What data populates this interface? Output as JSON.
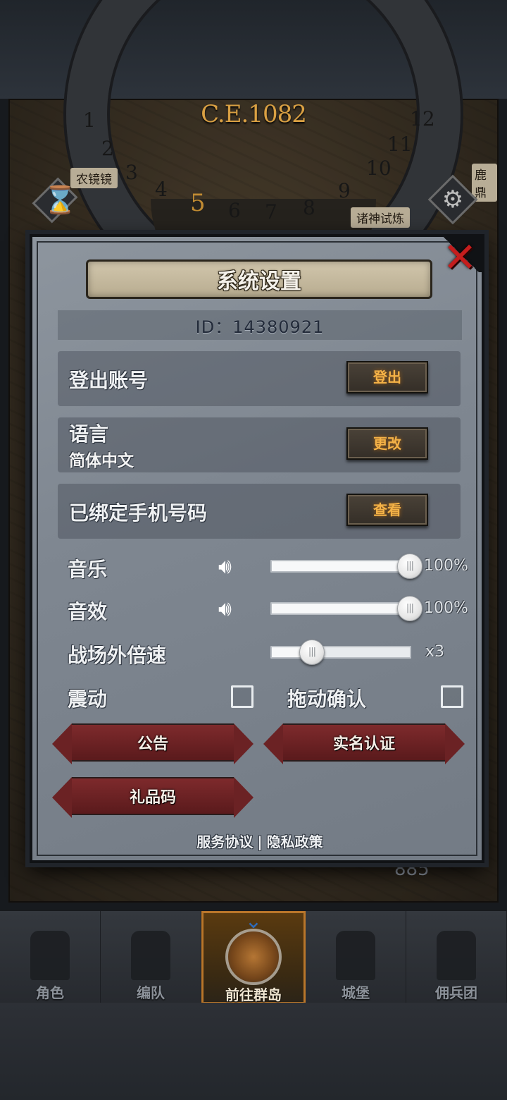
{
  "scene": {
    "era": "C.E.1082",
    "dial_numbers": [
      "1",
      "2",
      "3",
      "4",
      "5",
      "6",
      "7",
      "8",
      "9",
      "10",
      "11",
      "12"
    ],
    "active_number": "5",
    "left_label": "农镜镜",
    "right_label": "诸神试炼",
    "far_right_label": "鹿鼎",
    "currency_value": "885",
    "hourglass_glyph": "⌛",
    "gear_glyph": "⚙"
  },
  "dialog": {
    "title": "系统设置",
    "close_glyph": "✕",
    "id_text": "ID：14380921",
    "account": {
      "label": "登出账号",
      "button": "登出"
    },
    "language": {
      "label": "语言",
      "value": "简体中文",
      "button": "更改"
    },
    "phone": {
      "label": "已绑定手机号码",
      "button": "查看"
    },
    "music": {
      "label": "音乐",
      "value": "100%",
      "level": 1.0,
      "icon": "speaker-icon"
    },
    "sound": {
      "label": "音效",
      "value": "100%",
      "level": 1.0,
      "icon": "speaker-icon"
    },
    "battle_speed": {
      "label": "战场外倍速",
      "value": "x3",
      "level": 0.29
    },
    "vibration": {
      "label": "震动",
      "checked": false
    },
    "drag_confirm": {
      "label": "拖动确认",
      "checked": false
    },
    "notice_button": "公告",
    "realname_button": "实名认证",
    "gift_button": "礼品码",
    "footer": {
      "terms": "服务协议",
      "separator": "|",
      "privacy": "隐私政策"
    }
  },
  "bottom_nav": {
    "items": [
      {
        "label": "角色",
        "active": false
      },
      {
        "label": "编队",
        "active": false
      },
      {
        "label": "前往群岛",
        "active": true
      },
      {
        "label": "城堡",
        "active": false
      },
      {
        "label": "佣兵团",
        "active": false
      }
    ]
  },
  "colors": {
    "accent_gold": "#f4b247",
    "close_red": "#c51d1d",
    "button_red": "#7e2a2c",
    "panel_gray": "#8d959e"
  }
}
